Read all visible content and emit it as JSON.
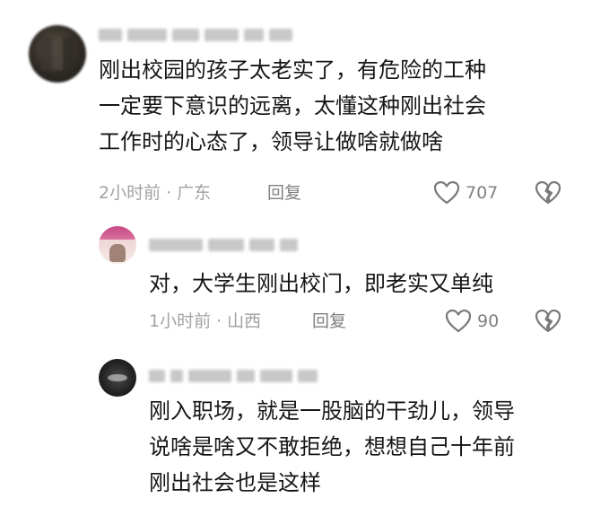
{
  "comments": [
    {
      "text_lines": [
        "刚出校园的孩子太老实了，有危险的工种",
        "一定要下意识的远离，太懂这种刚出社会",
        "工作时的心态了，领导让做啥就做啥"
      ],
      "time": "2小时前",
      "location": "广东",
      "reply_label": "回复",
      "like_count": "707"
    }
  ],
  "replies": [
    {
      "text_lines": [
        "对，大学生刚出校门，即老实又单纯"
      ],
      "time": "1小时前",
      "location": "山西",
      "reply_label": "回复",
      "like_count": "90"
    },
    {
      "text_lines": [
        "刚入职场，就是一股脑的干劲儿，领导",
        "说啥是啥又不敢拒绝，想想自己十年前",
        "刚出社会也是这样"
      ]
    }
  ],
  "icons": {
    "like": "heart-outline-icon",
    "dislike": "broken-heart-icon"
  },
  "colors": {
    "text": "#161616",
    "meta": "#a2a2a2",
    "icon": "#7a7a7a"
  }
}
